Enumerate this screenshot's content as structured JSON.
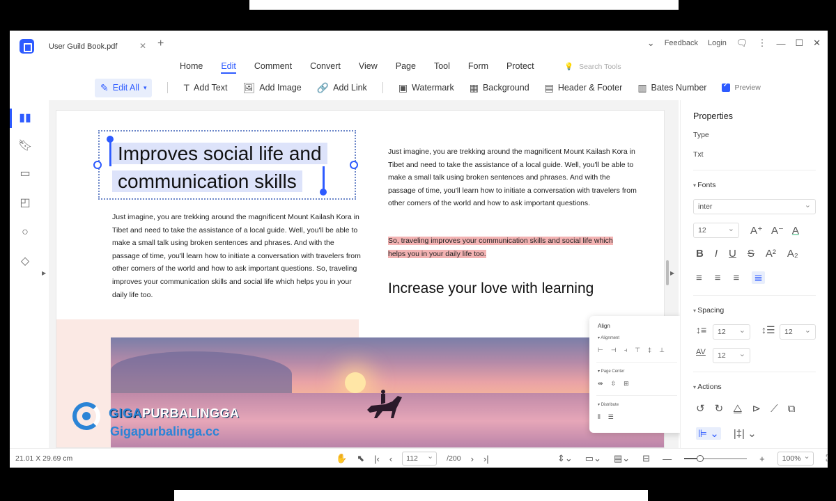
{
  "tab": {
    "title": "User Guild Book.pdf"
  },
  "window": {
    "feedback": "Feedback",
    "login": "Login"
  },
  "menu": [
    "Home",
    "Edit",
    "Comment",
    "Convert",
    "View",
    "Page",
    "Tool",
    "Form",
    "Protect"
  ],
  "menu_active_index": 1,
  "search": {
    "placeholder": "Search Tools"
  },
  "toolbar": {
    "edit_all": "Edit All",
    "add_text": "Add Text",
    "add_image": "Add Image",
    "add_link": "Add Link",
    "watermark": "Watermark",
    "background": "Background",
    "header_footer": "Header & Footer",
    "bates_number": "Bates Number",
    "preview": "Preview"
  },
  "document": {
    "headline_line1": "Improves social life and",
    "headline_line2": "communication skills",
    "left_paragraph": "Just imagine, you are trekking around the magnificent Mount Kailash Kora in Tibet and need to take the assistance of a local guide. Well, you'll be able to make a small talk using broken sentences and phrases. And with the passage of time, you'll learn how to initiate a conversation with travelers from other corners of the world and how to ask important questions. So, traveling improves your communication skills and social life which helps you in your daily life too.",
    "right_paragraph": "Just imagine, you are trekking around the magnificent Mount Kailash Kora in Tibet and need to take the assistance of a local guide. Well, you'll be able to make a small talk using broken sentences and phrases. And with the passage of time, you'll learn how to initiate a conversation with travelers from other corners of the world and how to ask important questions.",
    "highlight": "So, traveling improves your communication skills and social life which helps you in your daily life too.",
    "subheading": "Increase your love with learning"
  },
  "watermark": {
    "brand_a": "GIGA",
    "brand_b": "PURBALINGGA",
    "url": "Gigapurbalinga.cc"
  },
  "align_popup": {
    "title": "Align",
    "alignment": "Alignment",
    "page_center": "Page Center",
    "distribute": "Distribute"
  },
  "properties": {
    "title": "Properties",
    "type_label": "Type",
    "type_value": "Txt",
    "fonts_label": "Fonts",
    "font_family": "inter",
    "font_size": "12",
    "spacing_label": "Spacing",
    "line_spacing": "12",
    "para_spacing": "12",
    "char_spacing": "12",
    "actions_label": "Actions"
  },
  "status": {
    "dimensions": "21.01 X 29.69 cm",
    "current_page": "112",
    "total_pages": "/200",
    "zoom": "100%",
    "zoom_level": 0.25
  },
  "colors": {
    "accent": "#2e5bff",
    "highlight": "#f3b3b3"
  }
}
